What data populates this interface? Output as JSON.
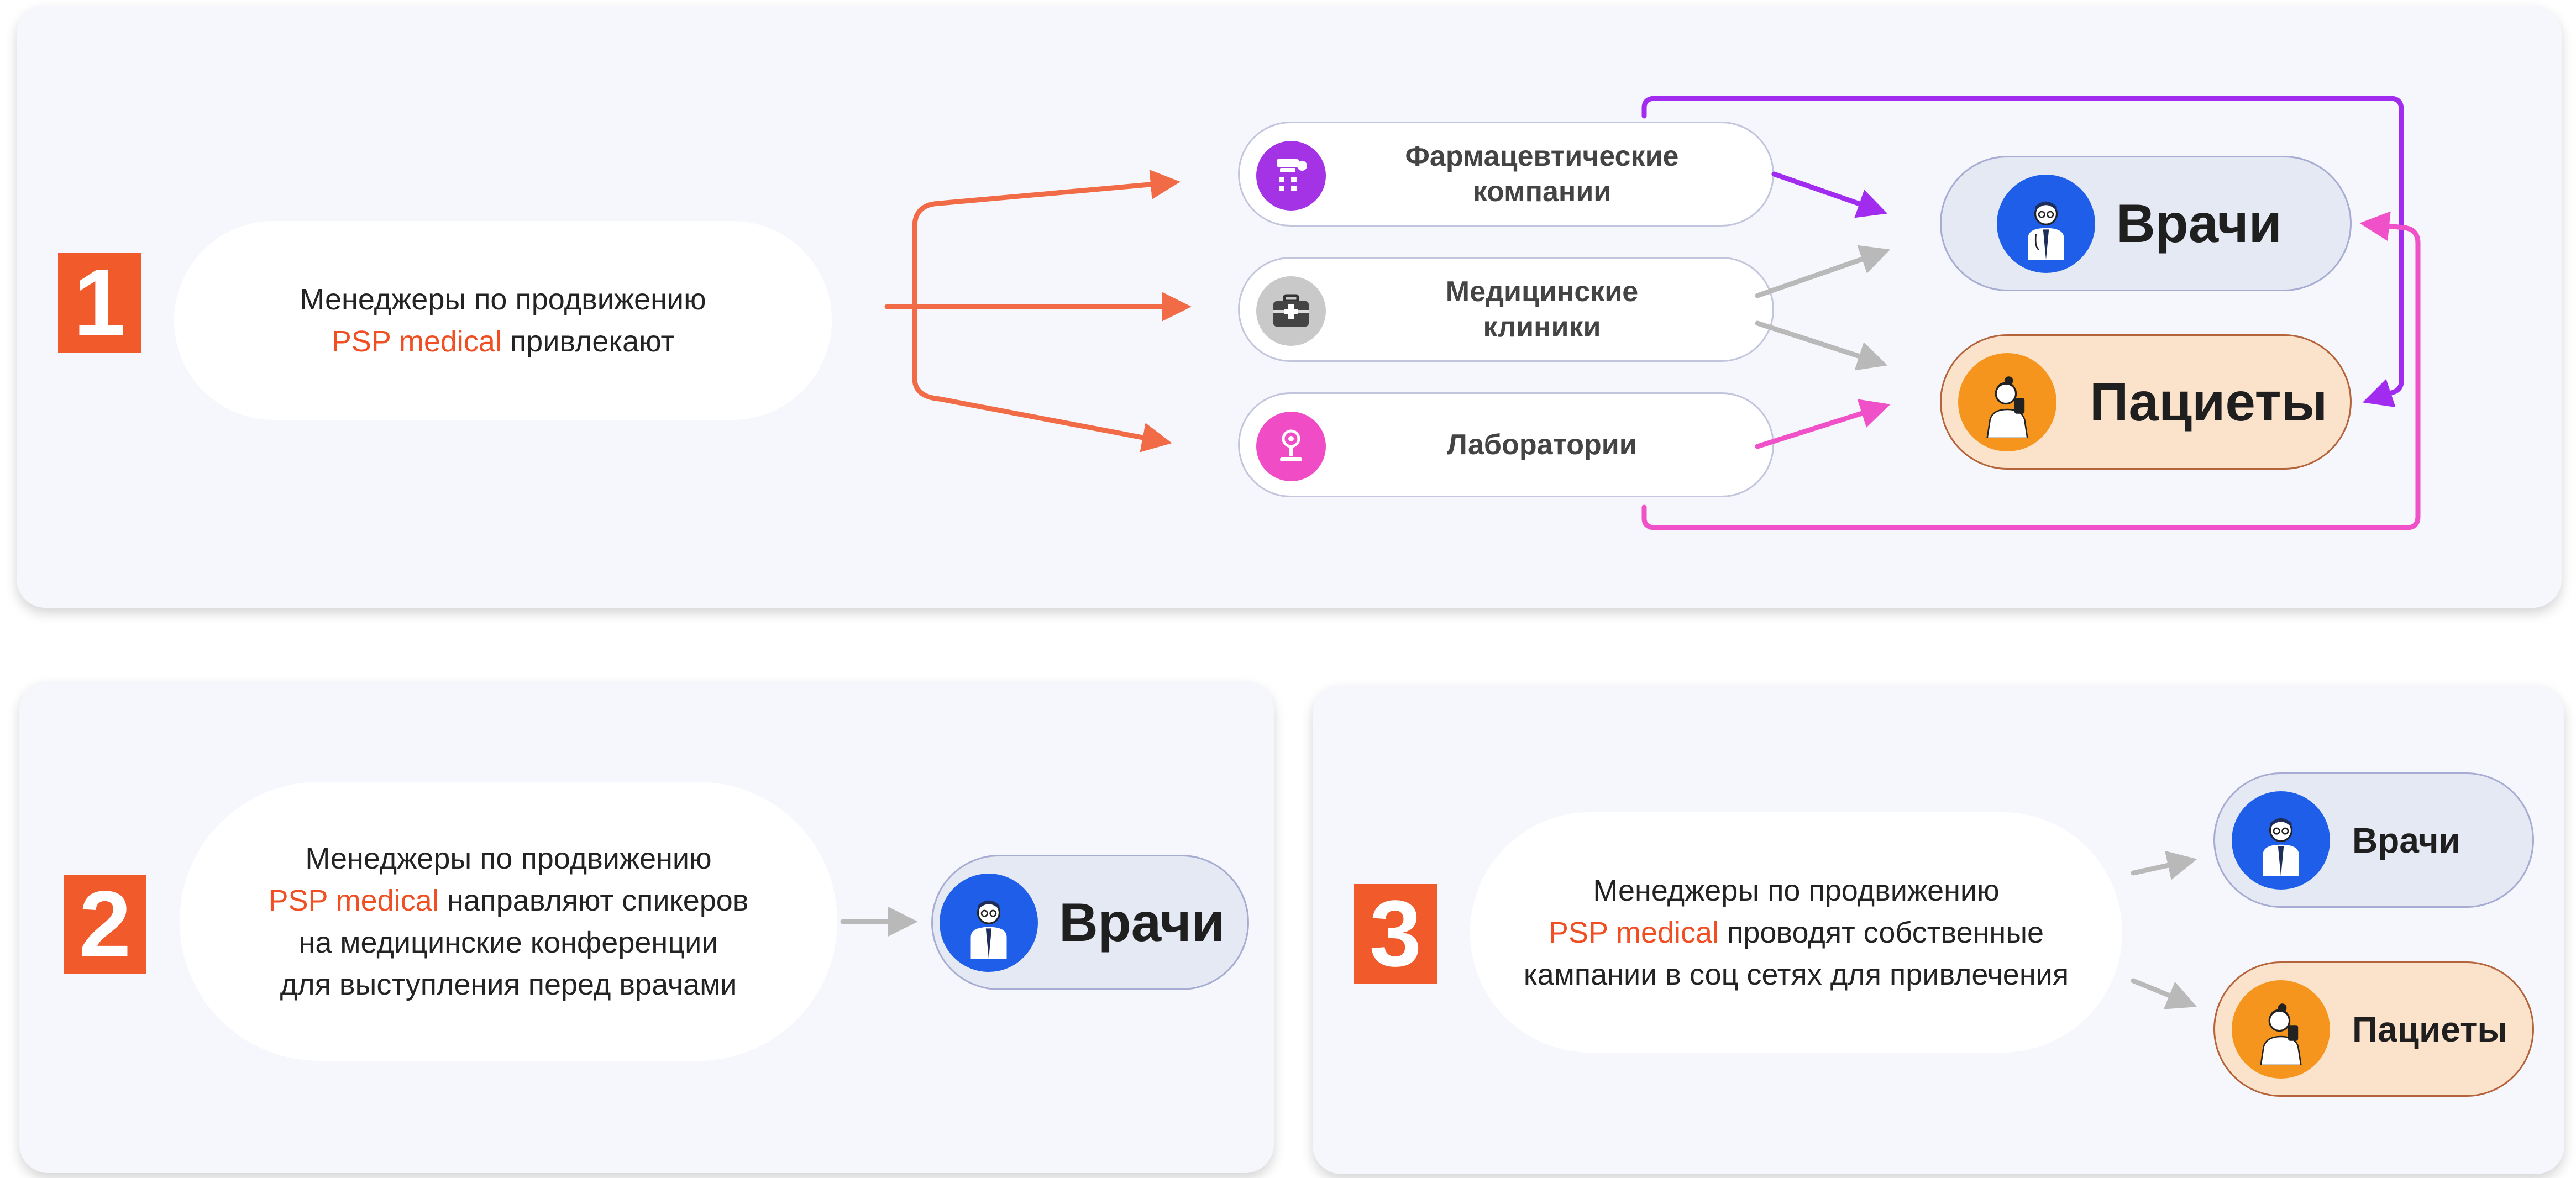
{
  "section1": {
    "number": "1",
    "text_line1": "Менеджеры по продвижению",
    "text_accent": "PSP medical",
    "text_rest": "привлекают",
    "sources": [
      {
        "line1": "Фармацевтические",
        "line2": "компании",
        "icon": "pharma-icon"
      },
      {
        "line1": "Медицинские",
        "line2": "клиники",
        "icon": "medical-case-icon"
      },
      {
        "line1": "Лаборатории",
        "line2": "",
        "icon": "microscope-icon"
      }
    ],
    "doctors_label": "Врачи",
    "patients_label": "Пациеты"
  },
  "section2": {
    "number": "2",
    "line1": "Менеджеры по продвижению",
    "accent": "PSP medical",
    "line2_rest": "направляют спикеров",
    "line3": "на медицинские конференции",
    "line4": "для выступления перед врачами",
    "doctors_label": "Врачи"
  },
  "section3": {
    "number": "3",
    "line1": "Менеджеры по продвижению",
    "accent": "PSP medical",
    "line2_rest": "проводят собственные",
    "line3": "кампании в соц сетях для привлечения",
    "doctors_label": "Врачи",
    "patients_label": "Пациеты"
  },
  "colors": {
    "accent": "#f04e23",
    "badge": "#f15a2b",
    "orange_arrow": "#f26b47",
    "purple_arrow": "#a12cf0",
    "pink_arrow": "#f050c8",
    "gray_arrow": "#b9b9b9",
    "doctor_blue": "#1e5ee8",
    "patient_orange": "#f5951d"
  }
}
